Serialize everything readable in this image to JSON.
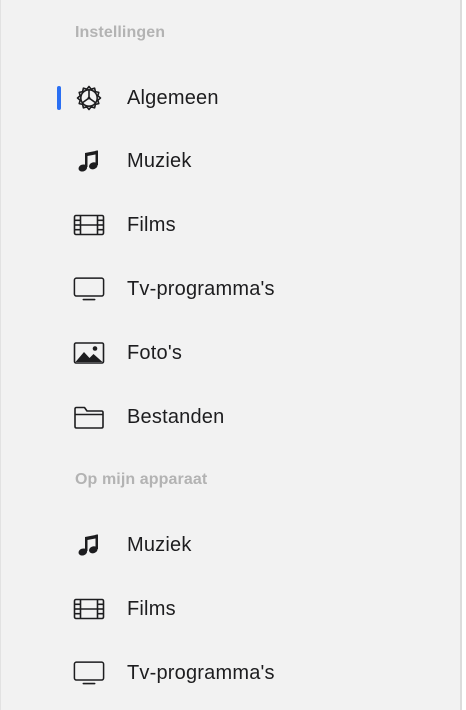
{
  "colors": {
    "accent": "#2a6ff3",
    "sidebar_bg": "#f2f2f2",
    "section_header": "#b3b3b3",
    "label": "#1d1d1f",
    "icon": "#1d1d1f"
  },
  "sections": [
    {
      "header": "Instellingen",
      "items": [
        {
          "label": "Algemeen",
          "icon": "gear-icon",
          "selected": true
        },
        {
          "label": "Muziek",
          "icon": "music-note-icon"
        },
        {
          "label": "Films",
          "icon": "film-icon"
        },
        {
          "label": "Tv-programma's",
          "icon": "tv-icon"
        },
        {
          "label": "Foto's",
          "icon": "photo-icon"
        },
        {
          "label": "Bestanden",
          "icon": "folder-icon"
        }
      ]
    },
    {
      "header": "Op mijn apparaat",
      "items": [
        {
          "label": "Muziek",
          "icon": "music-note-icon"
        },
        {
          "label": "Films",
          "icon": "film-icon"
        },
        {
          "label": "Tv-programma's",
          "icon": "tv-icon"
        }
      ]
    }
  ]
}
